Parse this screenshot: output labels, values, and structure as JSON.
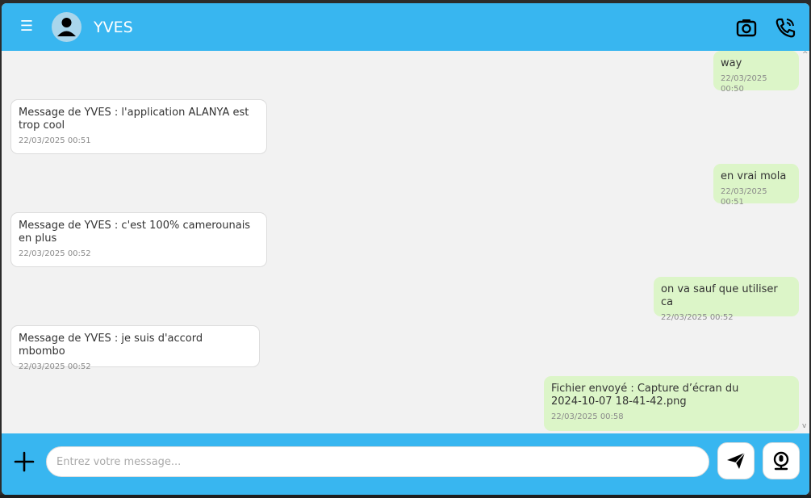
{
  "header": {
    "contact_name": "YVES",
    "menu_icon": "hamburger-icon",
    "avatar_icon": "user-avatar-icon",
    "camera_icon": "camera-icon",
    "call_icon": "phone-call-icon"
  },
  "messages": [
    {
      "direction": "out",
      "text": "way",
      "time": "22/03/2025 00:50"
    },
    {
      "direction": "in",
      "text": "Message de YVES : l'application ALANYA est\ntrop cool",
      "time": "22/03/2025 00:51"
    },
    {
      "direction": "out",
      "text": "en vrai mola",
      "time": "22/03/2025 00:51"
    },
    {
      "direction": "in",
      "text": "Message de YVES : c'est 100% camerounais\nen plus",
      "time": "22/03/2025 00:52"
    },
    {
      "direction": "out",
      "text": "on va sauf que utiliser ca",
      "time": "22/03/2025 00:52"
    },
    {
      "direction": "in",
      "text": "Message de YVES : je suis d'accord mbombo",
      "time": "22/03/2025 00:52"
    },
    {
      "direction": "out",
      "text": "Fichier envoyé : Capture d’écran du\n2024-10-07 18-41-42.png",
      "time": "22/03/2025 00:58"
    }
  ],
  "footer": {
    "attach_icon": "plus-icon",
    "input_placeholder": "Entrez votre message...",
    "input_value": "",
    "send_icon": "send-icon",
    "voice_icon": "microphone-icon"
  },
  "colors": {
    "accent": "#38b6f0",
    "incoming_bubble": "#ffffff",
    "outgoing_bubble": "#dcf5c8",
    "background": "#f2f2f2"
  }
}
